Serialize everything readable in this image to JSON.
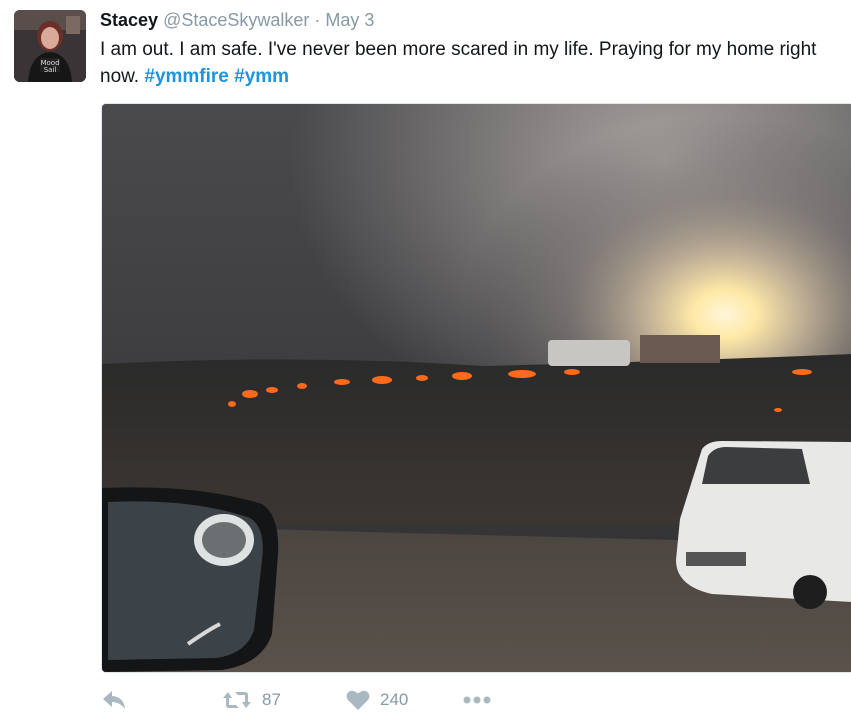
{
  "tweet": {
    "author_name": "Stacey",
    "handle": "@StaceSkywalker",
    "separator": "·",
    "date": "May 3",
    "text": "I am out. I am safe. I've never been more scared in my life. Praying for my home right now. ",
    "hashtags": [
      "#ymmfire",
      "#ymm"
    ]
  },
  "actions": {
    "reply_icon": "reply-icon",
    "retweet_icon": "retweet-icon",
    "retweet_count": "87",
    "like_icon": "heart-icon",
    "like_count": "240",
    "more_icon": "more-dots-icon"
  },
  "colors": {
    "hashtag": "#1b95e0",
    "muted": "#8899a6",
    "text": "#14171a"
  }
}
